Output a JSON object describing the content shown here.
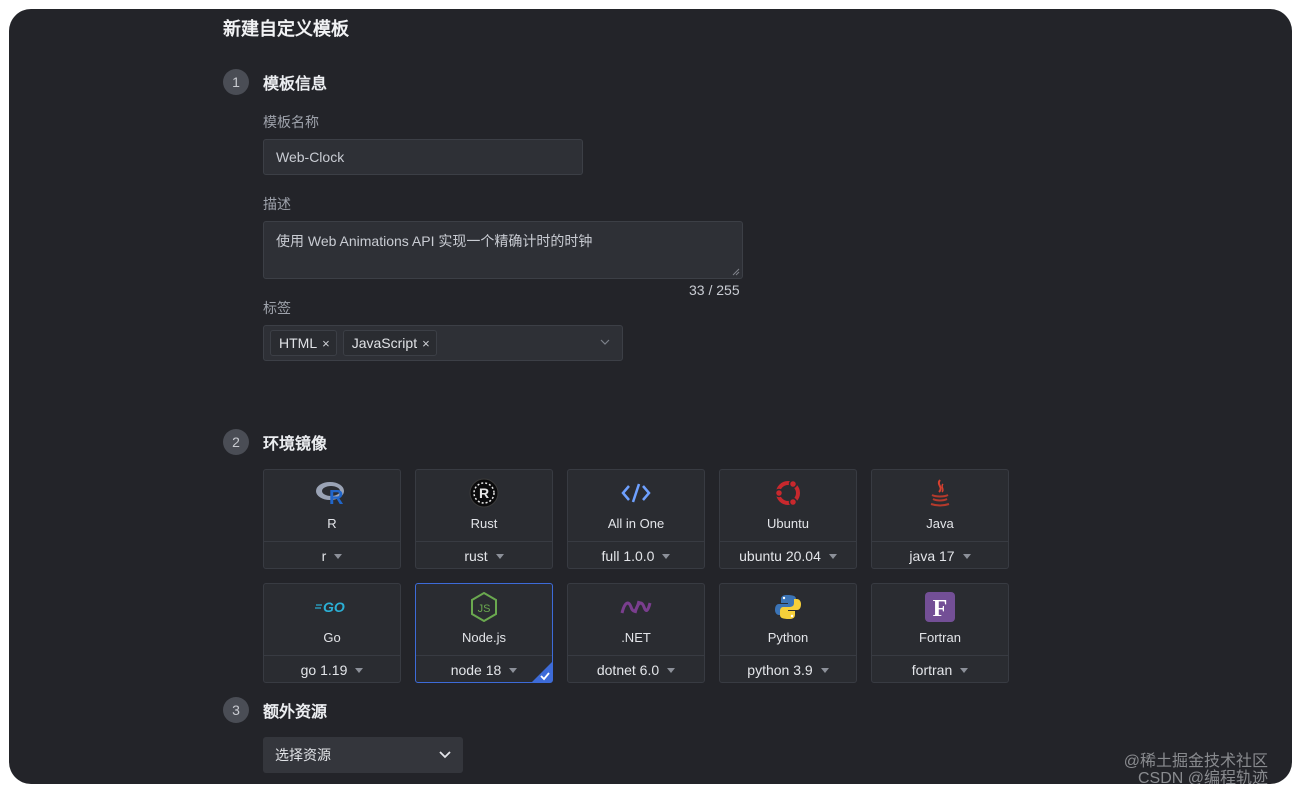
{
  "page": {
    "title": "新建自定义模板"
  },
  "steps": [
    {
      "num": "1",
      "title": "模板信息"
    },
    {
      "num": "2",
      "title": "环境镜像"
    },
    {
      "num": "3",
      "title": "额外资源"
    }
  ],
  "form": {
    "name_label": "模板名称",
    "name_value": "Web-Clock",
    "desc_label": "描述",
    "desc_value": "使用 Web Animations API 实现一个精确计时的时钟",
    "desc_counter": "33 / 255",
    "tags_label": "标签",
    "tags": [
      "HTML",
      "JavaScript"
    ],
    "tag_remove_glyph": "×"
  },
  "images": [
    {
      "name": "R",
      "version": "r",
      "icon": "r-logo-icon"
    },
    {
      "name": "Rust",
      "version": "rust",
      "icon": "rust-logo-icon"
    },
    {
      "name": "All in One",
      "version": "full 1.0.0",
      "icon": "code-icon"
    },
    {
      "name": "Ubuntu",
      "version": "ubuntu 20.04",
      "icon": "ubuntu-logo-icon"
    },
    {
      "name": "Java",
      "version": "java 17",
      "icon": "java-logo-icon"
    },
    {
      "name": "Go",
      "version": "go 1.19",
      "icon": "go-logo-icon",
      "logo_text": "GO"
    },
    {
      "name": "Node.js",
      "version": "node 18",
      "icon": "nodejs-logo-icon",
      "selected": true
    },
    {
      "name": ".NET",
      "version": "dotnet 6.0",
      "icon": "dotnet-logo-icon"
    },
    {
      "name": "Python",
      "version": "python 3.9",
      "icon": "python-logo-icon"
    },
    {
      "name": "Fortran",
      "version": "fortran",
      "icon": "fortran-logo-icon",
      "logo_text": "F"
    }
  ],
  "resources": {
    "select_label": "选择资源"
  },
  "watermark": {
    "line1": "@稀土掘金技术社区",
    "line2": "CSDN @编程轨迹"
  },
  "colors": {
    "accent": "#3d6bd8",
    "panel": "#232429",
    "card": "#2a2c31"
  }
}
